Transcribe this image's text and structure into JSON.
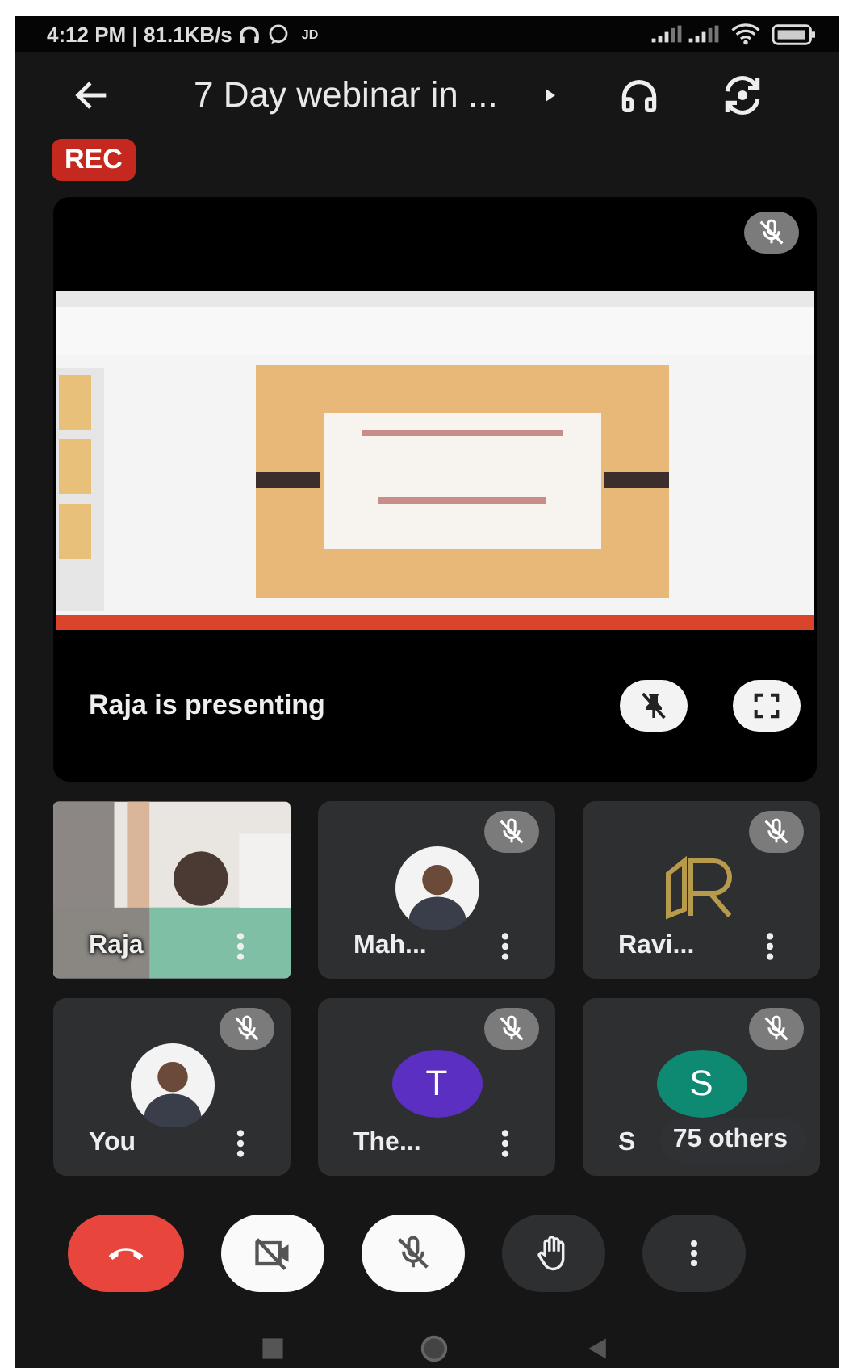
{
  "status_bar": {
    "time": "4:12 PM | 81.1KB/s",
    "carrier_tag": "JD"
  },
  "meeting": {
    "title": "7 Day webinar in ...",
    "recording_badge": "REC"
  },
  "presentation": {
    "kind": "picture",
    "mic_muted": true,
    "caption": "Raja is presenting"
  },
  "participants": [
    {
      "name": "Raja",
      "kind": "video",
      "mic_muted": false
    },
    {
      "name": "Mah...",
      "mic_muted": true
    },
    {
      "name": "Ravi...",
      "kind": "logo",
      "mic_muted": true
    },
    {
      "name": "You",
      "mic_muted": true
    },
    {
      "name": "The...",
      "kind": "initial",
      "initial": "T",
      "color": "#5b2fc2",
      "mic_muted": true
    },
    {
      "name": "S",
      "kind": "initial",
      "initial": "S",
      "color": "#0f8a72",
      "mic_muted": true,
      "overlay": "75 others"
    }
  ],
  "controls": [
    {
      "kind": "end_call"
    },
    {
      "kind": "camera",
      "on": false
    },
    {
      "kind": "mic",
      "on": false
    },
    {
      "kind": "hand"
    },
    {
      "kind": "more"
    }
  ]
}
